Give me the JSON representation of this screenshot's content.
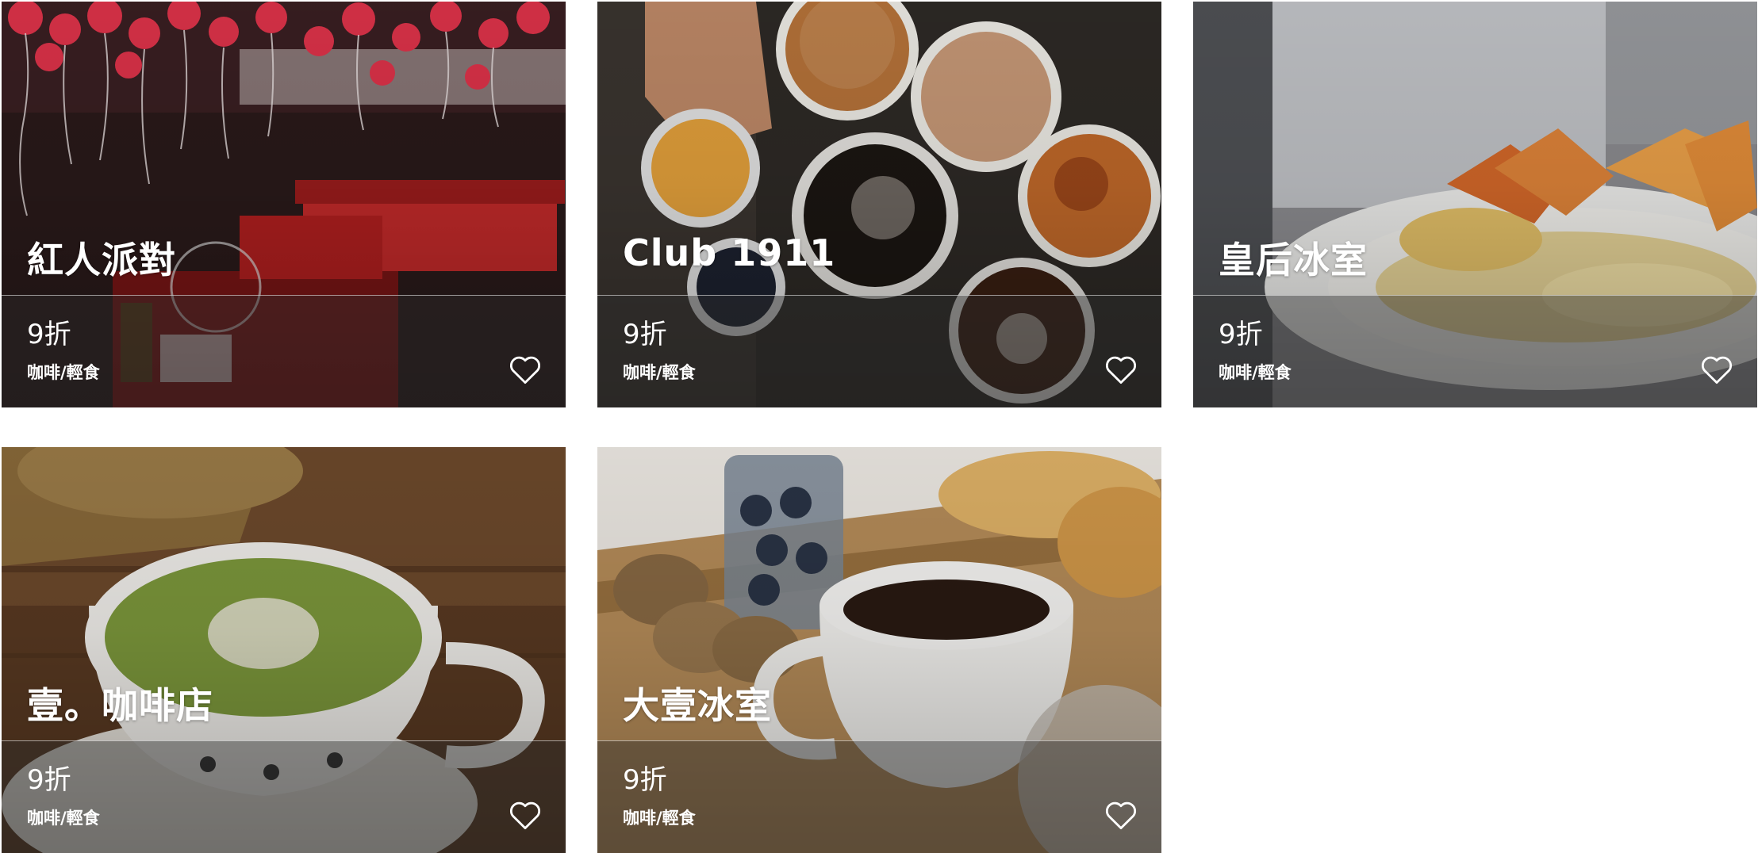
{
  "cards": [
    {
      "name": "紅人派對",
      "discount": "9折",
      "category": "咖啡/輕食",
      "icon": "heart-outline-icon",
      "scene": "party-room"
    },
    {
      "name": "Club 1911",
      "discount": "9折",
      "category": "咖啡/輕食",
      "icon": "heart-outline-icon",
      "scene": "beer-toast"
    },
    {
      "name": "皇后冰室",
      "discount": "9折",
      "category": "咖啡/輕食",
      "icon": "heart-outline-icon",
      "scene": "breakfast-plate"
    },
    {
      "name": "壹。咖啡店",
      "discount": "9折",
      "category": "咖啡/輕食",
      "icon": "heart-outline-icon",
      "scene": "matcha-latte"
    },
    {
      "name": "大壹冰室",
      "discount": "9折",
      "category": "咖啡/輕食",
      "icon": "heart-outline-icon",
      "scene": "coffee-tray"
    }
  ]
}
